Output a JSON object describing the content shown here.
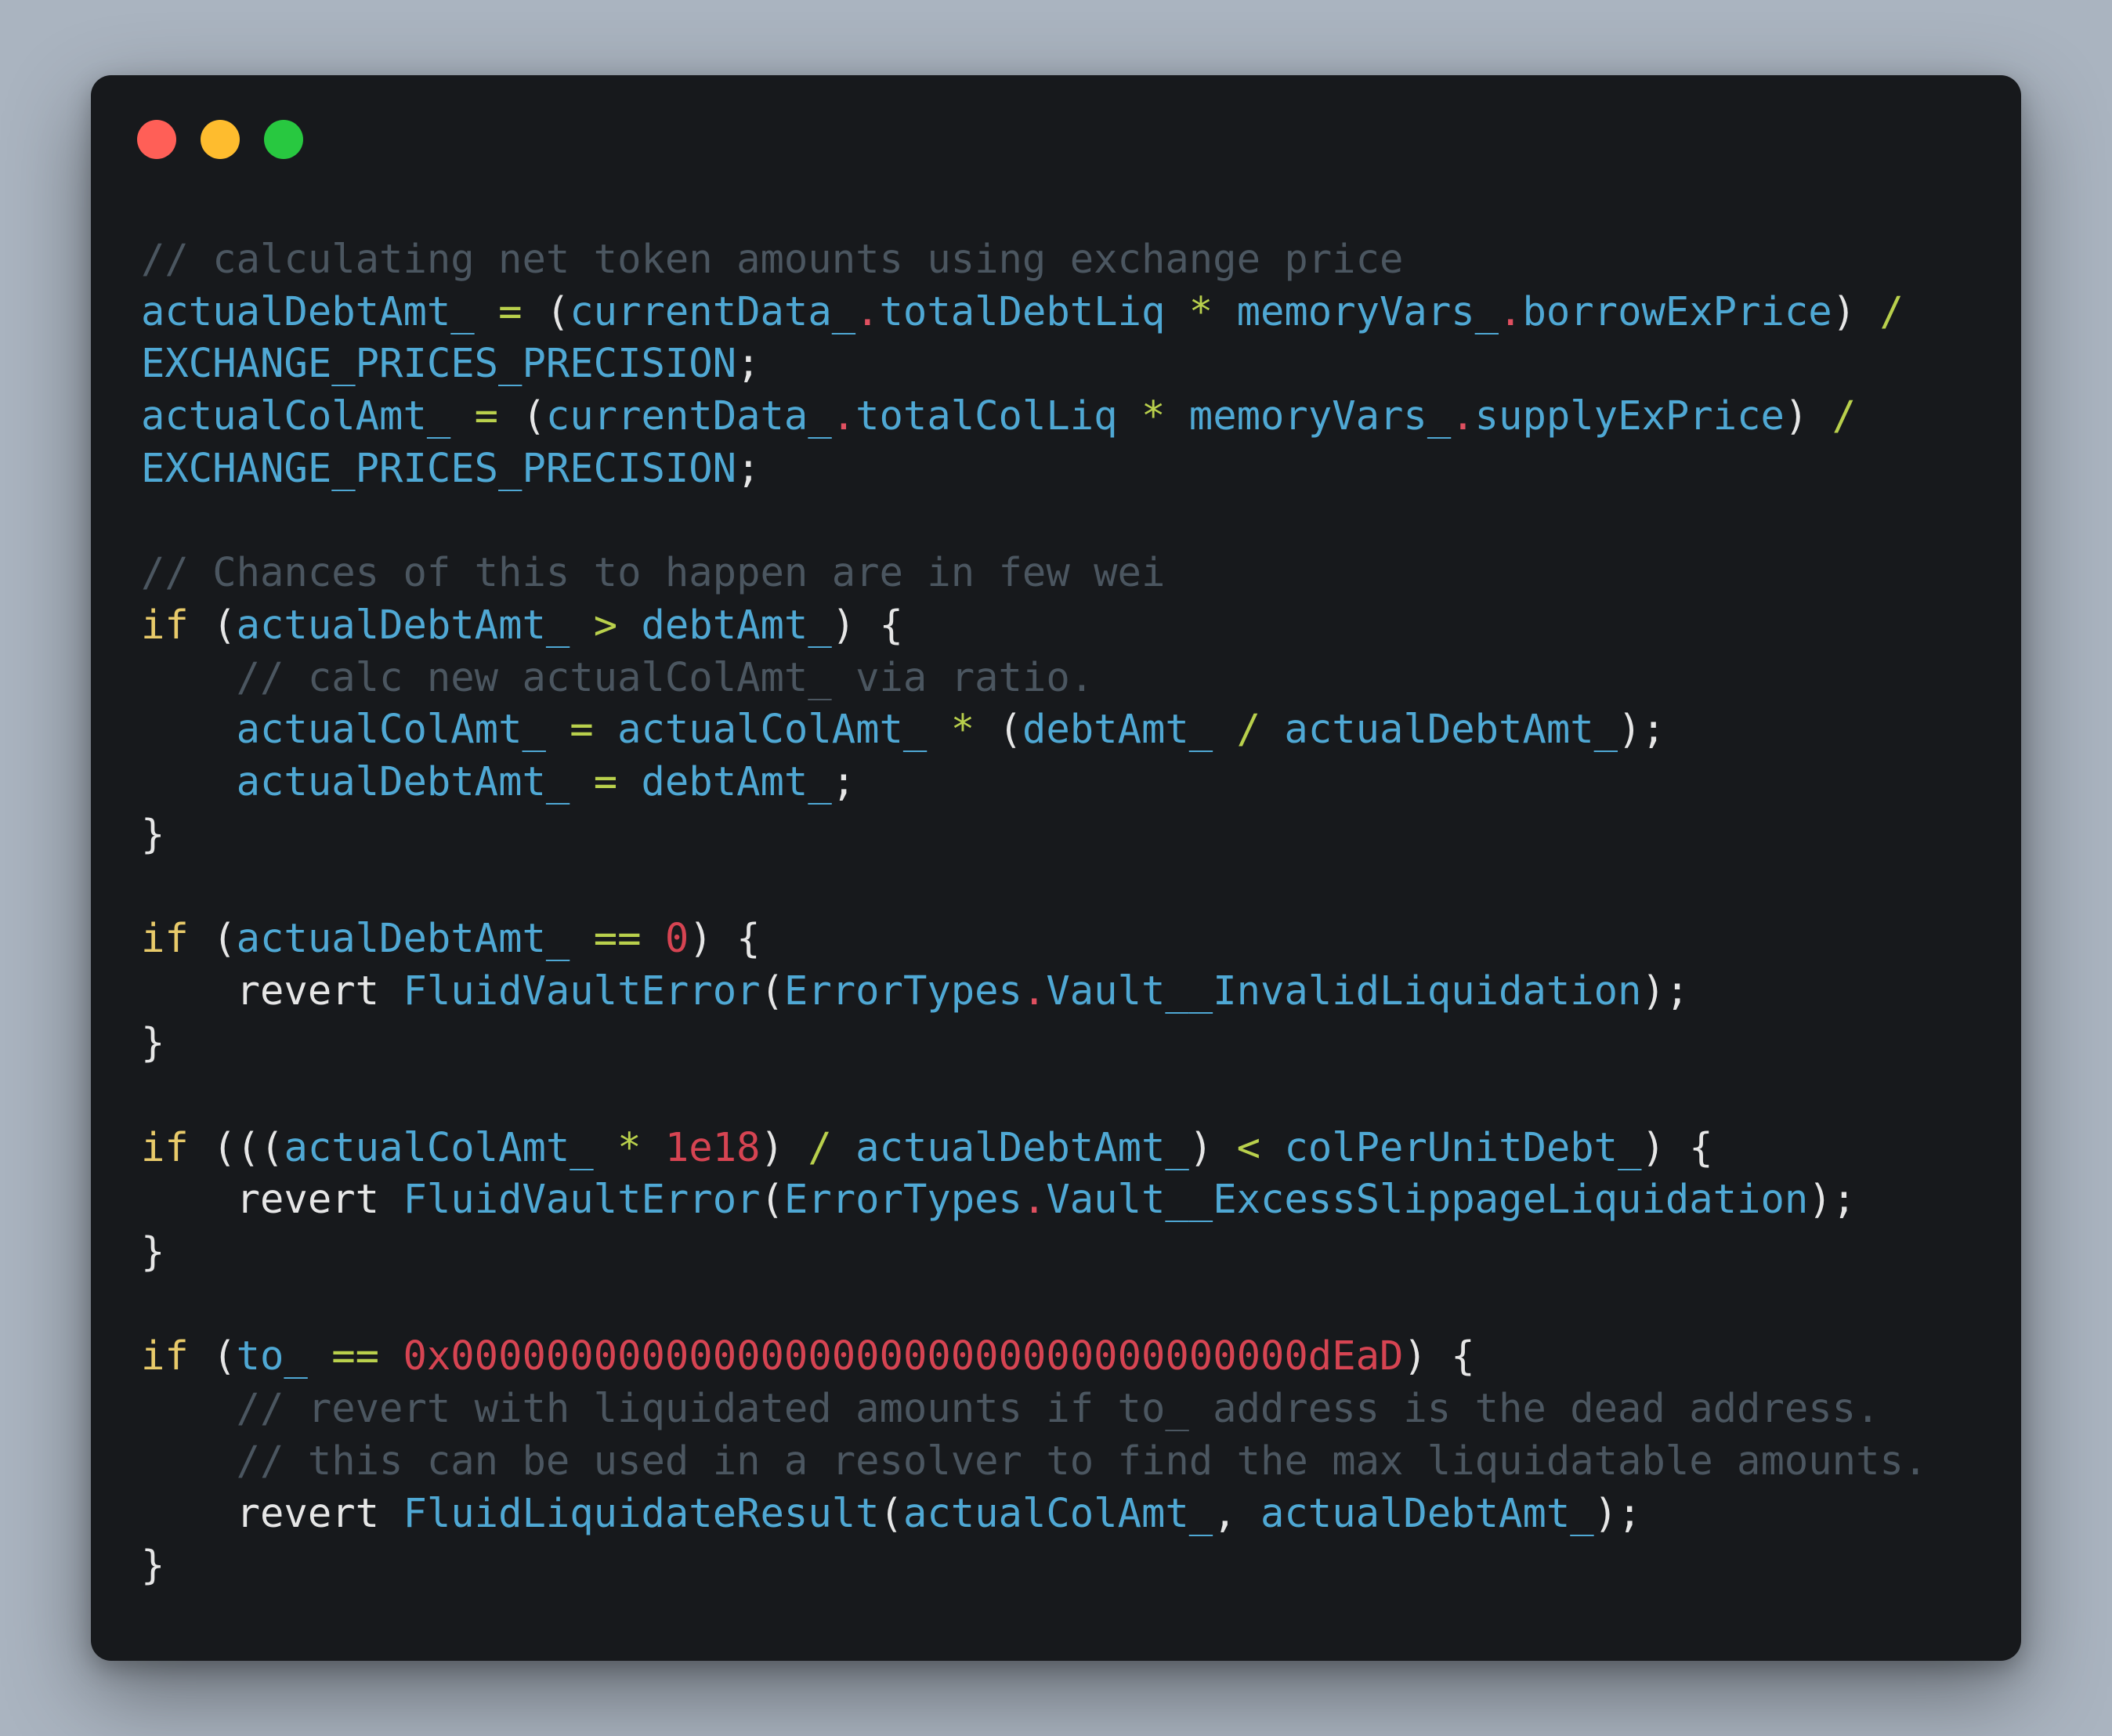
{
  "window": {
    "traffic_lights": {
      "close_color": "#ff5f57",
      "minimize_color": "#febc2e",
      "maximize_color": "#28c840"
    }
  },
  "colors": {
    "background": "#aab4c0",
    "editor_background": "#17191c",
    "comment": "#4b5660",
    "identifier": "#4fa8d4",
    "keyword": "#e8ca6a",
    "operator": "#b9d04c",
    "number": "#d64452",
    "plain": "#e6e6e6"
  },
  "code": {
    "lines": [
      [
        [
          "c",
          "// calculating net token amounts using exchange price"
        ]
      ],
      [
        [
          "v",
          "actualDebtAmt_"
        ],
        [
          "p",
          " "
        ],
        [
          "o",
          "="
        ],
        [
          "p",
          " ("
        ],
        [
          "v",
          "currentData_"
        ],
        [
          "d",
          "."
        ],
        [
          "v",
          "totalDebtLiq"
        ],
        [
          "p",
          " "
        ],
        [
          "o",
          "*"
        ],
        [
          "p",
          " "
        ],
        [
          "v",
          "memoryVars_"
        ],
        [
          "d",
          "."
        ],
        [
          "v",
          "borrowExPrice"
        ],
        [
          "p",
          ") "
        ],
        [
          "o",
          "/"
        ]
      ],
      [
        [
          "v",
          "EXCHANGE_PRICES_PRECISION"
        ],
        [
          "p",
          ";"
        ]
      ],
      [
        [
          "v",
          "actualColAmt_"
        ],
        [
          "p",
          " "
        ],
        [
          "o",
          "="
        ],
        [
          "p",
          " ("
        ],
        [
          "v",
          "currentData_"
        ],
        [
          "d",
          "."
        ],
        [
          "v",
          "totalColLiq"
        ],
        [
          "p",
          " "
        ],
        [
          "o",
          "*"
        ],
        [
          "p",
          " "
        ],
        [
          "v",
          "memoryVars_"
        ],
        [
          "d",
          "."
        ],
        [
          "v",
          "supplyExPrice"
        ],
        [
          "p",
          ") "
        ],
        [
          "o",
          "/"
        ]
      ],
      [
        [
          "v",
          "EXCHANGE_PRICES_PRECISION"
        ],
        [
          "p",
          ";"
        ]
      ],
      [],
      [
        [
          "c",
          "// Chances of this to happen are in few wei"
        ]
      ],
      [
        [
          "k",
          "if"
        ],
        [
          "p",
          " ("
        ],
        [
          "v",
          "actualDebtAmt_"
        ],
        [
          "p",
          " "
        ],
        [
          "o",
          ">"
        ],
        [
          "p",
          " "
        ],
        [
          "v",
          "debtAmt_"
        ],
        [
          "p",
          ") {"
        ]
      ],
      [
        [
          "p",
          "    "
        ],
        [
          "c",
          "// calc new actualColAmt_ via ratio."
        ]
      ],
      [
        [
          "p",
          "    "
        ],
        [
          "v",
          "actualColAmt_"
        ],
        [
          "p",
          " "
        ],
        [
          "o",
          "="
        ],
        [
          "p",
          " "
        ],
        [
          "v",
          "actualColAmt_"
        ],
        [
          "p",
          " "
        ],
        [
          "o",
          "*"
        ],
        [
          "p",
          " ("
        ],
        [
          "v",
          "debtAmt_"
        ],
        [
          "p",
          " "
        ],
        [
          "o",
          "/"
        ],
        [
          "p",
          " "
        ],
        [
          "v",
          "actualDebtAmt_"
        ],
        [
          "p",
          ");"
        ]
      ],
      [
        [
          "p",
          "    "
        ],
        [
          "v",
          "actualDebtAmt_"
        ],
        [
          "p",
          " "
        ],
        [
          "o",
          "="
        ],
        [
          "p",
          " "
        ],
        [
          "v",
          "debtAmt_"
        ],
        [
          "p",
          ";"
        ]
      ],
      [
        [
          "p",
          "}"
        ]
      ],
      [],
      [
        [
          "k",
          "if"
        ],
        [
          "p",
          " ("
        ],
        [
          "v",
          "actualDebtAmt_"
        ],
        [
          "p",
          " "
        ],
        [
          "o",
          "=="
        ],
        [
          "p",
          " "
        ],
        [
          "n",
          "0"
        ],
        [
          "p",
          ") {"
        ]
      ],
      [
        [
          "p",
          "    revert "
        ],
        [
          "v",
          "FluidVaultError"
        ],
        [
          "p",
          "("
        ],
        [
          "v",
          "ErrorTypes"
        ],
        [
          "d",
          "."
        ],
        [
          "v",
          "Vault__InvalidLiquidation"
        ],
        [
          "p",
          ");"
        ]
      ],
      [
        [
          "p",
          "}"
        ]
      ],
      [],
      [
        [
          "k",
          "if"
        ],
        [
          "p",
          " ((("
        ],
        [
          "v",
          "actualColAmt_"
        ],
        [
          "p",
          " "
        ],
        [
          "o",
          "*"
        ],
        [
          "p",
          " "
        ],
        [
          "n",
          "1e18"
        ],
        [
          "p",
          ") "
        ],
        [
          "o",
          "/"
        ],
        [
          "p",
          " "
        ],
        [
          "v",
          "actualDebtAmt_"
        ],
        [
          "p",
          ") "
        ],
        [
          "o",
          "<"
        ],
        [
          "p",
          " "
        ],
        [
          "v",
          "colPerUnitDebt_"
        ],
        [
          "p",
          ") {"
        ]
      ],
      [
        [
          "p",
          "    revert "
        ],
        [
          "v",
          "FluidVaultError"
        ],
        [
          "p",
          "("
        ],
        [
          "v",
          "ErrorTypes"
        ],
        [
          "d",
          "."
        ],
        [
          "v",
          "Vault__ExcessSlippageLiquidation"
        ],
        [
          "p",
          ");"
        ]
      ],
      [
        [
          "p",
          "}"
        ]
      ],
      [],
      [
        [
          "k",
          "if"
        ],
        [
          "p",
          " ("
        ],
        [
          "v",
          "to_"
        ],
        [
          "p",
          " "
        ],
        [
          "o",
          "=="
        ],
        [
          "p",
          " "
        ],
        [
          "n",
          "0x000000000000000000000000000000000000dEaD"
        ],
        [
          "p",
          ") {"
        ]
      ],
      [
        [
          "p",
          "    "
        ],
        [
          "c",
          "// revert with liquidated amounts if to_ address is the dead address."
        ]
      ],
      [
        [
          "p",
          "    "
        ],
        [
          "c",
          "// this can be used in a resolver to find the max liquidatable amounts."
        ]
      ],
      [
        [
          "p",
          "    revert "
        ],
        [
          "v",
          "FluidLiquidateResult"
        ],
        [
          "p",
          "("
        ],
        [
          "v",
          "actualColAmt_"
        ],
        [
          "p",
          ", "
        ],
        [
          "v",
          "actualDebtAmt_"
        ],
        [
          "p",
          ");"
        ]
      ],
      [
        [
          "p",
          "}"
        ]
      ]
    ]
  }
}
